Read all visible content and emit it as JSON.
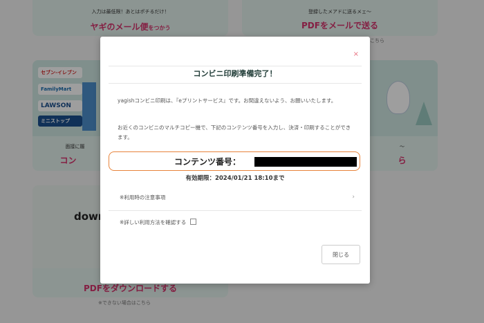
{
  "background": {
    "card1": {
      "caption": "入力は最低限！あとはポチるだけ！",
      "title": "ヤギのメール便",
      "title_suffix": "をつかう"
    },
    "card2": {
      "caption": "登録したメアドに送るメェ～",
      "title": "PDFをメールで送る",
      "note": "こちら"
    },
    "card3": {
      "logos": [
        "セブン-イレブン",
        "FamilyMart",
        "LAWSON",
        "ミニストップ"
      ],
      "caption": "面接に履",
      "title": "コン"
    },
    "card4": {
      "caption": "～",
      "title": "ら"
    },
    "card5": {
      "big_text": "down",
      "title": "PDFをダウンロードする",
      "note": "※できない場合はこちら"
    }
  },
  "modal": {
    "close_symbol": "×",
    "title": "コンビニ印刷準備完了！",
    "para1": "yagishコンビニ印刷は、『eプリントサービス』です。お間違えないよう、お願いいたします。",
    "para2": "お近くのコンビニのマルチコピー機で、下記のコンテンツ番号を入力し、決済・印刷することができます。",
    "content_number_label": "コンテンツ番号：",
    "expiry": "有効期限：2024/01/21 18:10まで",
    "notice_label": "※利用時の注意事項",
    "details_link": "※詳しい利用方法を確認する",
    "close_button": "閉じる"
  },
  "colors": {
    "accent": "#d6336c",
    "border_orange": "#e8833a",
    "card_bg": "#e3f1ec"
  }
}
